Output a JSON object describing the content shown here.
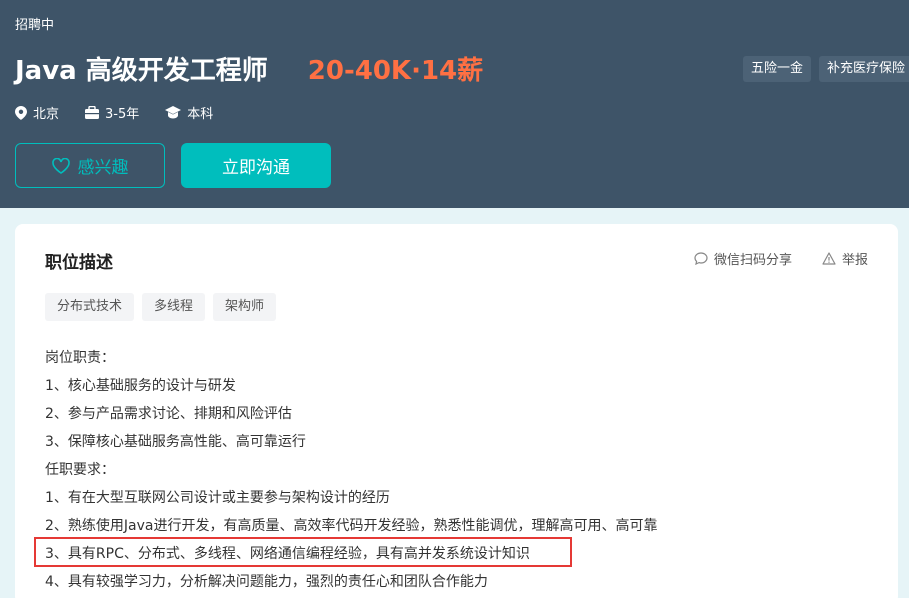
{
  "header": {
    "status": "招聘中",
    "job_title": "Java 高级开发工程师",
    "salary": "20-40K·14薪",
    "benefits": [
      "五险一金",
      "补充医疗保险"
    ],
    "meta": {
      "location": "北京",
      "experience": "3-5年",
      "education": "本科"
    },
    "interest_button": "感兴趣",
    "chat_button": "立即沟通"
  },
  "card": {
    "section_title": "职位描述",
    "share_label": "微信扫码分享",
    "report_label": "举报",
    "tags": [
      "分布式技术",
      "多线程",
      "架构师"
    ],
    "description": [
      "岗位职责：",
      "1、核心基础服务的设计与研发",
      "2、参与产品需求讨论、排期和风险评估",
      "3、保障核心基础服务高性能、高可靠运行",
      "任职要求：",
      "1、有在大型互联网公司设计或主要参与架构设计的经历",
      "2、熟练使用Java进行开发，有高质量、高效率代码开发经验，熟悉性能调优，理解高可用、高可靠",
      "3、具有RPC、分布式、多线程、网络通信编程经验，具有高并发系统设计知识",
      "4、具有较强学习力，分析解决问题能力，强烈的责任心和团队合作能力"
    ]
  },
  "colors": {
    "header_bg": "#3e5468",
    "accent": "#00bebd",
    "salary": "#ff7043",
    "highlight_border": "#e53935"
  }
}
